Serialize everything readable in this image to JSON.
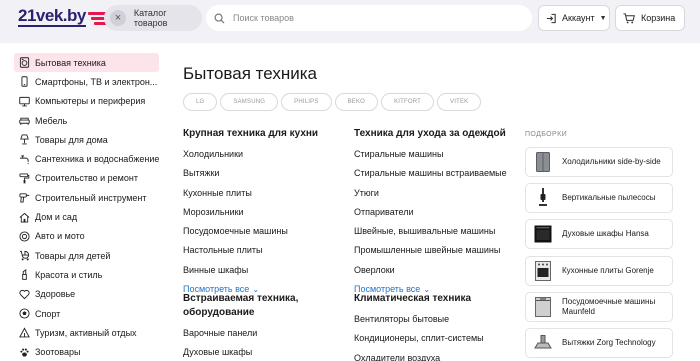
{
  "header": {
    "logo": "21vek.by",
    "catalog_label": "Каталог товаров",
    "search_placeholder": "Поиск товаров",
    "account_label": "Аккаунт",
    "cart_label": "Корзина",
    "brand_color": "#2a2170",
    "accent_color": "#e4184f"
  },
  "sidebar": {
    "items": [
      {
        "label": "Бытовая техника",
        "icon": "washing-machine-icon",
        "active": true
      },
      {
        "label": "Смартфоны, ТВ и электрон...",
        "icon": "phone-icon"
      },
      {
        "label": "Компьютеры и периферия",
        "icon": "monitor-icon"
      },
      {
        "label": "Мебель",
        "icon": "sofa-icon"
      },
      {
        "label": "Товары для дома",
        "icon": "lamp-icon"
      },
      {
        "label": "Сантехника и водоснабжение",
        "icon": "faucet-icon"
      },
      {
        "label": "Строительство и ремонт",
        "icon": "roller-icon"
      },
      {
        "label": "Строительный инструмент",
        "icon": "drill-icon"
      },
      {
        "label": "Дом и сад",
        "icon": "house-icon"
      },
      {
        "label": "Авто и мото",
        "icon": "wheel-icon"
      },
      {
        "label": "Товары для детей",
        "icon": "stroller-icon"
      },
      {
        "label": "Красота и стиль",
        "icon": "lipstick-icon"
      },
      {
        "label": "Здоровье",
        "icon": "heart-icon"
      },
      {
        "label": "Спорт",
        "icon": "ball-icon"
      },
      {
        "label": "Туризм, активный отдых",
        "icon": "tent-icon"
      },
      {
        "label": "Зоотовары",
        "icon": "paw-icon"
      }
    ]
  },
  "main": {
    "title": "Бытовая техника",
    "brands": [
      "LG",
      "SAMSUNG",
      "PHILIPS",
      "BEKO",
      "KITFORT",
      "VITEK"
    ],
    "more_label": "Посмотреть все",
    "groups": [
      {
        "title": "Крупная техника для кухни",
        "links": [
          "Холодильники",
          "Вытяжки",
          "Кухонные плиты",
          "Морозильники",
          "Посудомоечные машины",
          "Настольные плиты",
          "Винные шкафы"
        ]
      },
      {
        "title": "Техника для ухода за одеждой",
        "links": [
          "Стиральные машины",
          "Стиральные машины встраиваемые",
          "Утюги",
          "Отпариватели",
          "Швейные, вышивальные машины",
          "Промышленные швейные машины",
          "Оверлоки"
        ]
      },
      {
        "title": "Встраиваемая техника, оборудование",
        "links": [
          "Варочные панели",
          "Духовые шкафы"
        ]
      },
      {
        "title": "Климатическая техника",
        "links": [
          "Вентиляторы бытовые",
          "Кондиционеры, сплит-системы",
          "Охладители воздуха"
        ]
      }
    ],
    "podborki": {
      "title": "ПОДБОРКИ",
      "items": [
        {
          "label": "Холодильники side-by-side",
          "icon": "fridge-icon"
        },
        {
          "label": "Вертикальные пылесосы",
          "icon": "vacuum-icon"
        },
        {
          "label": "Духовые шкафы Hansa",
          "icon": "oven-icon"
        },
        {
          "label": "Кухонные плиты Gorenje",
          "icon": "stove-icon"
        },
        {
          "label": "Посудомоечные машины Maunfeld",
          "icon": "dishwasher-icon"
        },
        {
          "label": "Вытяжки Zorg Technology",
          "icon": "hood-icon"
        }
      ]
    }
  }
}
